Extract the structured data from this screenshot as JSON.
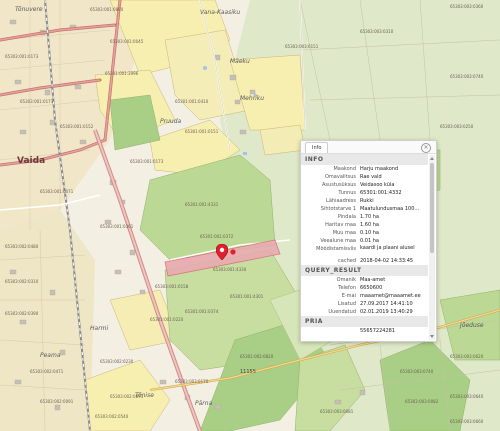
{
  "map": {
    "colors": {
      "background": "#f3efe2",
      "field_green": "#c8dea0",
      "forest_green": "#a9cf86",
      "yellow_area": "#f7efb0",
      "red_road": "#c9706b",
      "railway": "#8a8a8a",
      "highlight": "#e8aab0",
      "marker": "#e0202a"
    },
    "town_label": "Vaida",
    "place_labels": [
      "Vana-Kaasiku",
      "Mäeku",
      "Mehriku",
      "Pruuda",
      "Peama",
      "Tõnise",
      "Jõeduse",
      "Pärna",
      "Harmi",
      "Tõnuvere"
    ],
    "road_label": "11155",
    "parcel_labels": [
      "65303:003:0360",
      "65303:001:0173",
      "65303:003:0740",
      "65303:003:0151",
      "65303:001:0880",
      "65301:001:3996",
      "65301:001:0410",
      "65301:001:4331",
      "65301:001:0151",
      "65303:001:0152",
      "65303:001:0071",
      "65303:001:4330",
      "65303:001:0158",
      "65303:001:0173",
      "65303:002:0480",
      "65303:002:0390",
      "65303:002:0471",
      "65303:002:0230",
      "65303:002:0540",
      "65303:003:0310",
      "65301:001:0372",
      "65301:001:0374",
      "65303:003:0620",
      "65303:003:0082",
      "65303:003:0640",
      "65303:001:0045",
      "65301:001:4301",
      "65303:001:0220",
      "65301:002:0820",
      "65303:001:0171",
      "65303:003:0250",
      "65303:001:0361",
      "65303:003:0170",
      "65303:003:0360",
      "65303:002:0310",
      "65303:002:0091",
      "65303:002:0871",
      "65303:003:0081",
      "65303:003:0740",
      "65303:003:0660"
    ]
  },
  "marker": {
    "name": "location-marker"
  },
  "popup": {
    "tab_label": "Info",
    "close_label": "×",
    "sections": [
      {
        "title": "INFO",
        "rows": [
          {
            "key": "Maakond",
            "value": "Harju maakond"
          },
          {
            "key": "Omavalitsus",
            "value": "Rae vald"
          },
          {
            "key": "Asustusüksus",
            "value": "Veidasoo küla"
          },
          {
            "key": "Tunnus",
            "value": "65301:001:4332"
          },
          {
            "key": "Lähiaadress",
            "value": "Rukki"
          },
          {
            "key": "Sihtotstarve 1",
            "value": "Maatulundusmaa 100..."
          },
          {
            "key": "Pindala",
            "value": "1.70 ha"
          },
          {
            "key": "Haritav maa",
            "value": "1.60 ha"
          },
          {
            "key": "Muu maa",
            "value": "0.10 ha"
          },
          {
            "key": "Veealune maa",
            "value": "0.01 ha"
          },
          {
            "key": "Mõõdistamisviis",
            "value": "kaardi ja plaani alusel"
          },
          {
            "key": "cached",
            "value": "2018-04-02 14:33:45"
          }
        ]
      },
      {
        "title": "QUERY_RESULT",
        "rows": [
          {
            "key": "Omanik",
            "value": "Maa-amet"
          },
          {
            "key": "Telefon",
            "value": "6650600"
          },
          {
            "key": "E-mai",
            "value": "maaamet@maaamet.ee"
          },
          {
            "key": "Lisatud",
            "value": "27.09.2017 14:41:10"
          },
          {
            "key": "Uuendatud",
            "value": "02.01.2019 13:40:29"
          }
        ]
      },
      {
        "title": "PRIA",
        "rows": [
          {
            "key": "",
            "value": "55657224281"
          }
        ]
      }
    ]
  }
}
